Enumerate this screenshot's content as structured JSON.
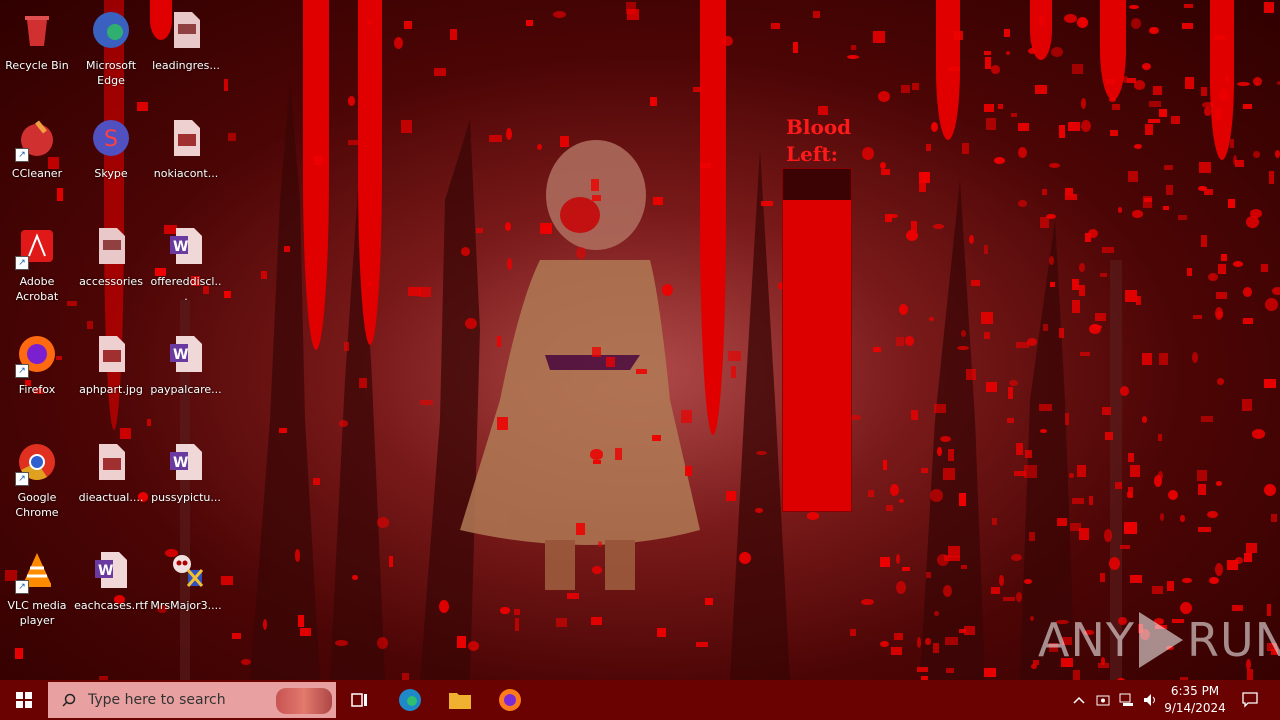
{
  "desktop_icons": [
    {
      "label": "Recycle Bin",
      "icon": "recycle-bin-icon"
    },
    {
      "label": "Microsoft Edge",
      "icon": "edge-icon"
    },
    {
      "label": "leadingres...",
      "icon": "document-icon"
    },
    {
      "label": "CCleaner",
      "icon": "ccleaner-icon"
    },
    {
      "label": "Skype",
      "icon": "skype-icon"
    },
    {
      "label": "nokiacont...",
      "icon": "image-file-icon"
    },
    {
      "label": "Adobe Acrobat",
      "icon": "acrobat-icon"
    },
    {
      "label": "accessories",
      "icon": "document-icon"
    },
    {
      "label": "offereddiscl...",
      "icon": "word-icon"
    },
    {
      "label": "Firefox",
      "icon": "firefox-icon"
    },
    {
      "label": "aphpart.jpg",
      "icon": "image-file-icon"
    },
    {
      "label": "paypalcare...",
      "icon": "word-icon"
    },
    {
      "label": "Google Chrome",
      "icon": "chrome-icon"
    },
    {
      "label": "dieactual....",
      "icon": "image-file-icon"
    },
    {
      "label": "pussypictu...",
      "icon": "word-icon"
    },
    {
      "label": "VLC media player",
      "icon": "vlc-icon"
    },
    {
      "label": "eachcases.rtf",
      "icon": "word-icon"
    },
    {
      "label": "MrsMajor3....",
      "icon": "skull-icon"
    }
  ],
  "blood_meter": {
    "title": "Blood Left:",
    "level_fraction": 0.91,
    "color": "#dd0000"
  },
  "watermark": {
    "left": "ANY",
    "right": "RUN"
  },
  "taskbar": {
    "search_placeholder": "Type here to search",
    "clock_time": "6:35 PM",
    "clock_date": "9/14/2024"
  },
  "colors": {
    "blood": "#e00000",
    "taskbar": "#6a0202"
  }
}
